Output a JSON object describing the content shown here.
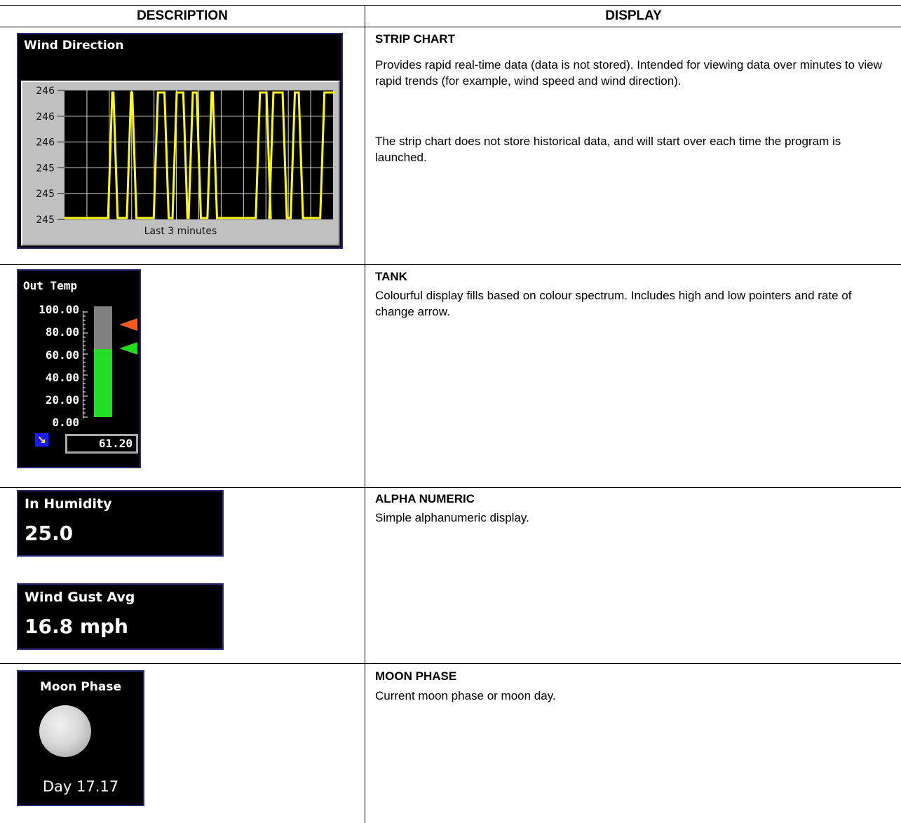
{
  "table": {
    "col_left_header": "DESCRIPTION",
    "col_right_header": "DISPLAY"
  },
  "rows": [
    {
      "title": "STRIP CHART",
      "text1": "Provides rapid real-time data (data is not stored). Intended for viewing data over minutes to view rapid trends (for example, wind speed and wind direction).",
      "text2": "The strip chart does not store historical data, and will start over each time the program is launched."
    },
    {
      "title": "TANK",
      "text1": "Colourful display fills based on colour spectrum. Includes high and low pointers and rate of change arrow."
    },
    {
      "title": "ALPHA NUMERIC",
      "text1": "Simple alphanumeric display."
    },
    {
      "title": "MOON PHASE",
      "text1": "Current moon phase or moon day."
    }
  ],
  "strip_chart": {
    "title": "Wind Direction",
    "x_caption": "Last 3 minutes",
    "y_tick_labels": [
      "246",
      "246",
      "246",
      "245",
      "245",
      "245"
    ],
    "line_color": "#ffff00",
    "grid": true
  },
  "tank": {
    "title": "Out Temp",
    "tick_labels": [
      "100.00",
      "80.00",
      "60.00",
      "40.00",
      "20.00",
      "0.00"
    ],
    "value": "61.20",
    "fill_level": 0.612,
    "high_pointer": 0.8,
    "low_pointer": 0.6,
    "rate_icon": "arrow-down-right-icon"
  },
  "alpha": [
    {
      "title": "In Humidity",
      "value": "25.0"
    },
    {
      "title": "Wind Gust Avg",
      "value": "16.8 mph"
    }
  ],
  "moon": {
    "title": "Moon Phase",
    "day": "Day  17.17"
  }
}
